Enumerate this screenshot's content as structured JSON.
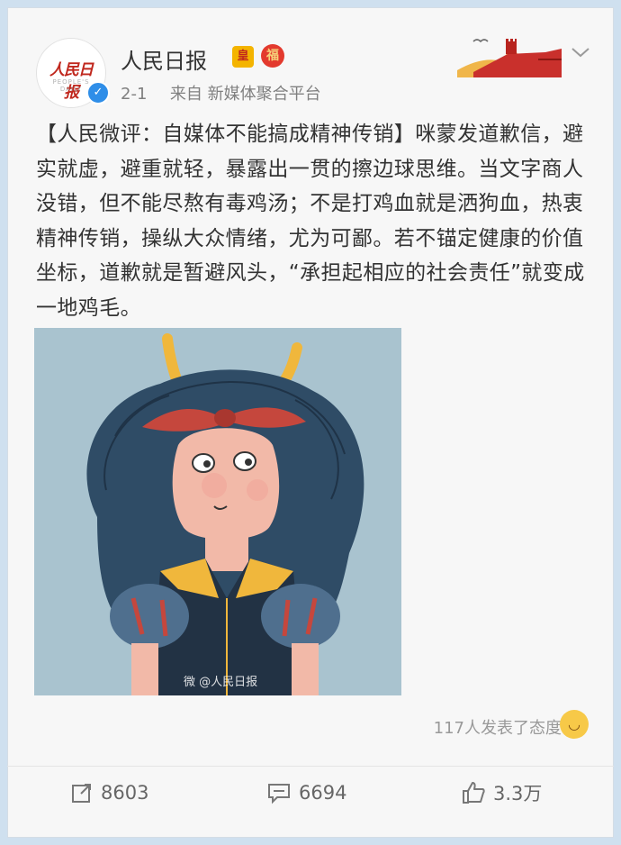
{
  "user": {
    "name": "人民日报",
    "logo_text": "人民日报",
    "logo_sub": "PEOPLE'S DAILY",
    "vip_badge": "皇",
    "fu_badge": "福",
    "date": "2-1",
    "source": "来自 新媒体聚合平台"
  },
  "post": {
    "tag": "【人民微评：自媒体不能搞成精神传销】",
    "text": "咪蒙发道歉信，避实就虚，避重就轻，暴露出一贯的擦边球思维。当文字商人没错，但不能尽熬有毒鸡汤；不是打鸡血就是洒狗血，热衷精神传销，操纵大众情绪，尤为可鄙。若不锚定健康的价值坐标，道歉就是暂避风头，“承担起相应的社会责任”就变成一地鸡毛。"
  },
  "image": {
    "watermark": "微 @人民日报"
  },
  "reactions": {
    "text": "117人发表了态度"
  },
  "actions": {
    "repost": "8603",
    "comment": "6694",
    "like": "3.3万"
  },
  "colors": {
    "page_bg": "#cfe0ef",
    "card_bg": "#f7f7f7",
    "verified_blue": "#2f8ee8",
    "text": "#333333",
    "meta": "#808080"
  }
}
